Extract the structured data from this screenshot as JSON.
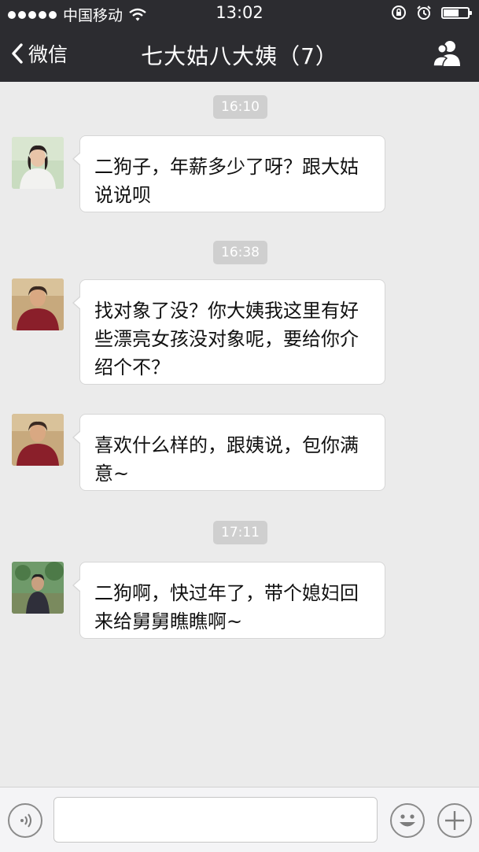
{
  "status_bar": {
    "carrier": "中国移动",
    "time": "13:02",
    "battery_level": 0.6
  },
  "nav": {
    "back_label": "微信",
    "title": "七大姑八大姨（7）"
  },
  "messages": [
    {
      "timestamp": "16:10",
      "text": "二狗子，年薪多少了呀？跟大姑说说呗"
    },
    {
      "timestamp": "16:38",
      "text": "找对象了没？你大姨我这里有好些漂亮女孩没对象呢，要给你介绍个不？"
    },
    {
      "timestamp": "",
      "text": "喜欢什么样的，跟姨说，包你满意~"
    },
    {
      "timestamp": "17:11",
      "text": "二狗啊，快过年了，带个媳妇回来给舅舅瞧瞧啊~"
    }
  ],
  "icons": {
    "signal": "signal-dots-icon",
    "wifi": "wifi-icon",
    "lock_rotation": "rotation-lock-icon",
    "alarm": "alarm-icon",
    "battery": "battery-icon",
    "back": "chevron-left-icon",
    "members": "group-members-icon",
    "voice": "voice-icon",
    "emoji": "emoji-icon",
    "more": "plus-icon"
  },
  "colors": {
    "top_bar": "#2c2c30",
    "chat_background": "#ebebeb",
    "bubble": "#ffffff",
    "timestamp_pill": "#cfcfcf"
  }
}
